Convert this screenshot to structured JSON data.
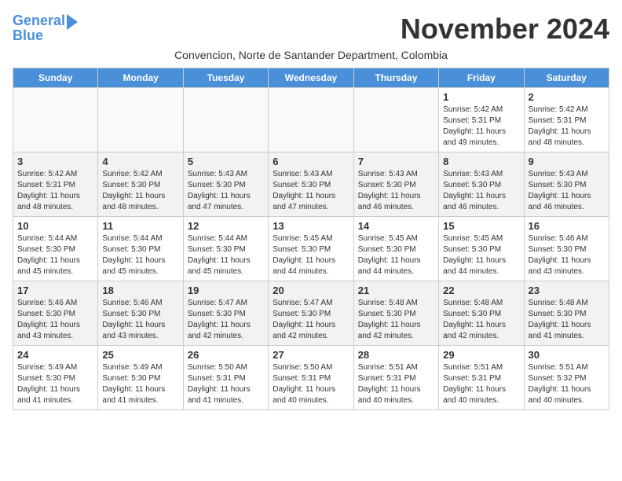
{
  "header": {
    "logo_line1": "General",
    "logo_line2": "Blue",
    "month_title": "November 2024",
    "location": "Convencion, Norte de Santander Department, Colombia"
  },
  "weekdays": [
    "Sunday",
    "Monday",
    "Tuesday",
    "Wednesday",
    "Thursday",
    "Friday",
    "Saturday"
  ],
  "weeks": [
    [
      {
        "day": "",
        "info": ""
      },
      {
        "day": "",
        "info": ""
      },
      {
        "day": "",
        "info": ""
      },
      {
        "day": "",
        "info": ""
      },
      {
        "day": "",
        "info": ""
      },
      {
        "day": "1",
        "info": "Sunrise: 5:42 AM\nSunset: 5:31 PM\nDaylight: 11 hours and 49 minutes."
      },
      {
        "day": "2",
        "info": "Sunrise: 5:42 AM\nSunset: 5:31 PM\nDaylight: 11 hours and 48 minutes."
      }
    ],
    [
      {
        "day": "3",
        "info": "Sunrise: 5:42 AM\nSunset: 5:31 PM\nDaylight: 11 hours and 48 minutes."
      },
      {
        "day": "4",
        "info": "Sunrise: 5:42 AM\nSunset: 5:30 PM\nDaylight: 11 hours and 48 minutes."
      },
      {
        "day": "5",
        "info": "Sunrise: 5:43 AM\nSunset: 5:30 PM\nDaylight: 11 hours and 47 minutes."
      },
      {
        "day": "6",
        "info": "Sunrise: 5:43 AM\nSunset: 5:30 PM\nDaylight: 11 hours and 47 minutes."
      },
      {
        "day": "7",
        "info": "Sunrise: 5:43 AM\nSunset: 5:30 PM\nDaylight: 11 hours and 46 minutes."
      },
      {
        "day": "8",
        "info": "Sunrise: 5:43 AM\nSunset: 5:30 PM\nDaylight: 11 hours and 46 minutes."
      },
      {
        "day": "9",
        "info": "Sunrise: 5:43 AM\nSunset: 5:30 PM\nDaylight: 11 hours and 46 minutes."
      }
    ],
    [
      {
        "day": "10",
        "info": "Sunrise: 5:44 AM\nSunset: 5:30 PM\nDaylight: 11 hours and 45 minutes."
      },
      {
        "day": "11",
        "info": "Sunrise: 5:44 AM\nSunset: 5:30 PM\nDaylight: 11 hours and 45 minutes."
      },
      {
        "day": "12",
        "info": "Sunrise: 5:44 AM\nSunset: 5:30 PM\nDaylight: 11 hours and 45 minutes."
      },
      {
        "day": "13",
        "info": "Sunrise: 5:45 AM\nSunset: 5:30 PM\nDaylight: 11 hours and 44 minutes."
      },
      {
        "day": "14",
        "info": "Sunrise: 5:45 AM\nSunset: 5:30 PM\nDaylight: 11 hours and 44 minutes."
      },
      {
        "day": "15",
        "info": "Sunrise: 5:45 AM\nSunset: 5:30 PM\nDaylight: 11 hours and 44 minutes."
      },
      {
        "day": "16",
        "info": "Sunrise: 5:46 AM\nSunset: 5:30 PM\nDaylight: 11 hours and 43 minutes."
      }
    ],
    [
      {
        "day": "17",
        "info": "Sunrise: 5:46 AM\nSunset: 5:30 PM\nDaylight: 11 hours and 43 minutes."
      },
      {
        "day": "18",
        "info": "Sunrise: 5:46 AM\nSunset: 5:30 PM\nDaylight: 11 hours and 43 minutes."
      },
      {
        "day": "19",
        "info": "Sunrise: 5:47 AM\nSunset: 5:30 PM\nDaylight: 11 hours and 42 minutes."
      },
      {
        "day": "20",
        "info": "Sunrise: 5:47 AM\nSunset: 5:30 PM\nDaylight: 11 hours and 42 minutes."
      },
      {
        "day": "21",
        "info": "Sunrise: 5:48 AM\nSunset: 5:30 PM\nDaylight: 11 hours and 42 minutes."
      },
      {
        "day": "22",
        "info": "Sunrise: 5:48 AM\nSunset: 5:30 PM\nDaylight: 11 hours and 42 minutes."
      },
      {
        "day": "23",
        "info": "Sunrise: 5:48 AM\nSunset: 5:30 PM\nDaylight: 11 hours and 41 minutes."
      }
    ],
    [
      {
        "day": "24",
        "info": "Sunrise: 5:49 AM\nSunset: 5:30 PM\nDaylight: 11 hours and 41 minutes."
      },
      {
        "day": "25",
        "info": "Sunrise: 5:49 AM\nSunset: 5:30 PM\nDaylight: 11 hours and 41 minutes."
      },
      {
        "day": "26",
        "info": "Sunrise: 5:50 AM\nSunset: 5:31 PM\nDaylight: 11 hours and 41 minutes."
      },
      {
        "day": "27",
        "info": "Sunrise: 5:50 AM\nSunset: 5:31 PM\nDaylight: 11 hours and 40 minutes."
      },
      {
        "day": "28",
        "info": "Sunrise: 5:51 AM\nSunset: 5:31 PM\nDaylight: 11 hours and 40 minutes."
      },
      {
        "day": "29",
        "info": "Sunrise: 5:51 AM\nSunset: 5:31 PM\nDaylight: 11 hours and 40 minutes."
      },
      {
        "day": "30",
        "info": "Sunrise: 5:51 AM\nSunset: 5:32 PM\nDaylight: 11 hours and 40 minutes."
      }
    ]
  ]
}
